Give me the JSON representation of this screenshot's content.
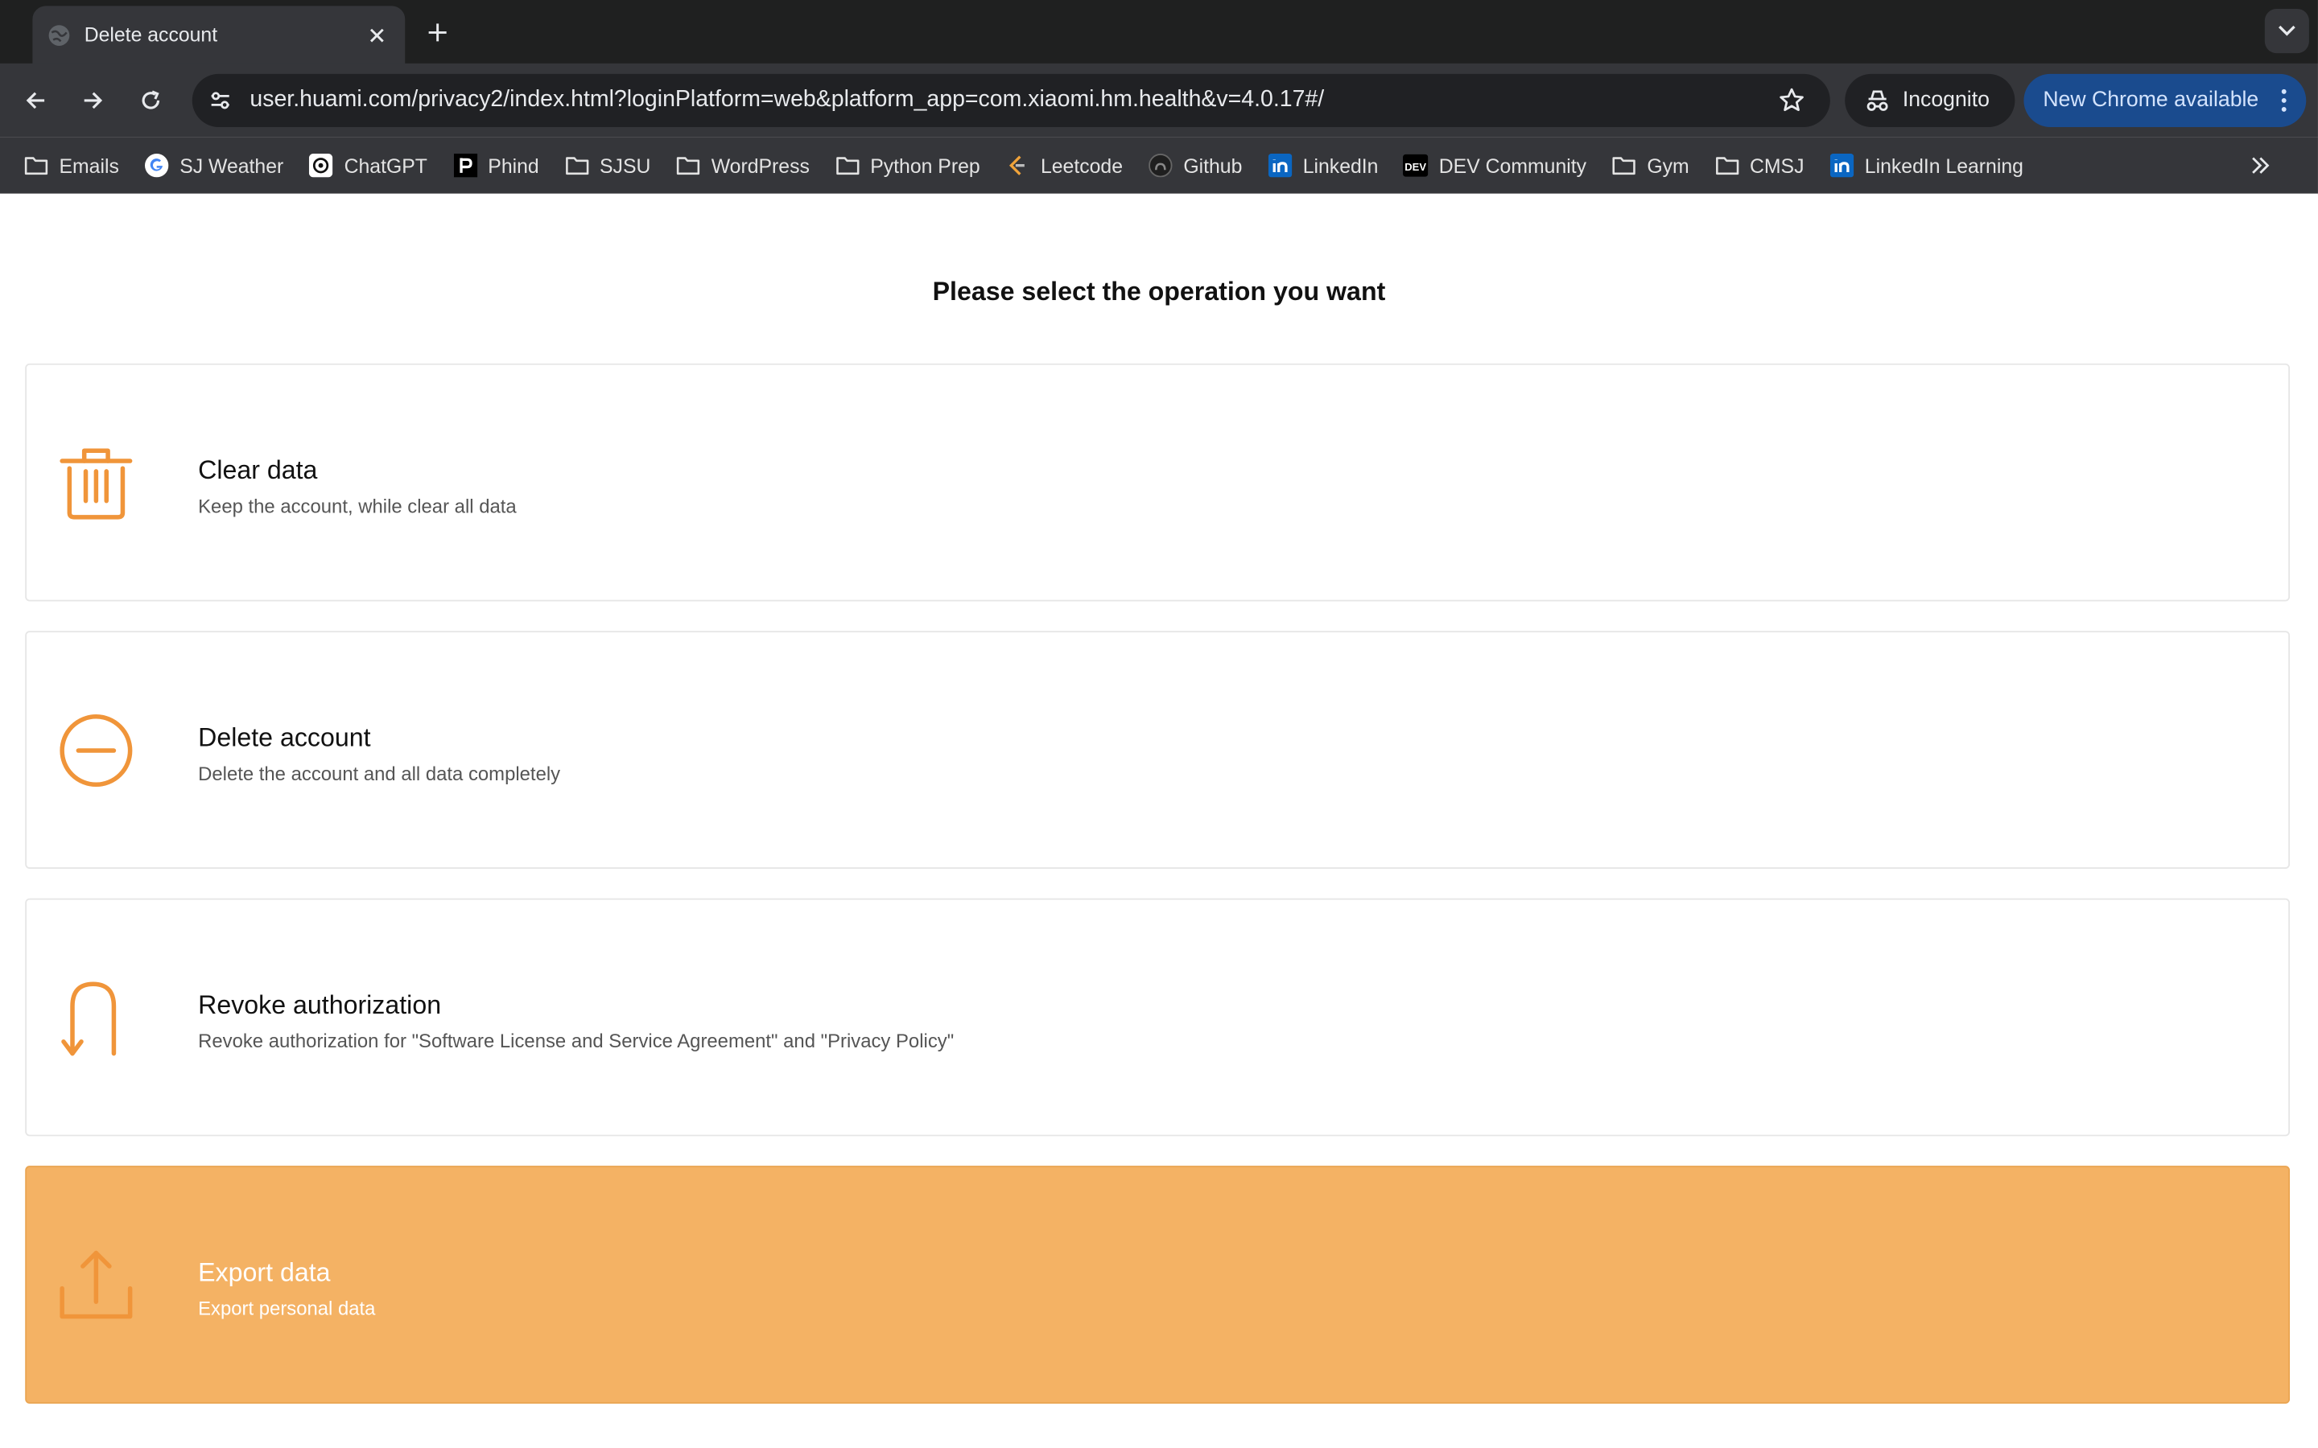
{
  "browser": {
    "tab_title": "Delete account",
    "url": "user.huami.com/privacy2/index.html?loginPlatform=web&platform_app=com.xiaomi.hm.health&v=4.0.17#/",
    "incognito_label": "Incognito",
    "update_label": "New Chrome available",
    "bookmarks": [
      {
        "label": "Emails",
        "icon": "folder-icon"
      },
      {
        "label": "SJ Weather",
        "icon": "google-icon"
      },
      {
        "label": "ChatGPT",
        "icon": "chatgpt-icon"
      },
      {
        "label": "Phind",
        "icon": "phind-icon"
      },
      {
        "label": "SJSU",
        "icon": "folder-icon"
      },
      {
        "label": "WordPress",
        "icon": "folder-icon"
      },
      {
        "label": "Python Prep",
        "icon": "folder-icon"
      },
      {
        "label": "Leetcode",
        "icon": "leetcode-icon"
      },
      {
        "label": "Github",
        "icon": "github-icon"
      },
      {
        "label": "LinkedIn",
        "icon": "linkedin-icon"
      },
      {
        "label": "DEV Community",
        "icon": "dev-icon"
      },
      {
        "label": "Gym",
        "icon": "folder-icon"
      },
      {
        "label": "CMSJ",
        "icon": "folder-icon"
      },
      {
        "label": "LinkedIn Learning",
        "icon": "linkedin-icon"
      }
    ]
  },
  "page": {
    "heading": "Please select the operation you want",
    "options": [
      {
        "title": "Clear data",
        "desc": "Keep the account, while clear all data",
        "icon": "trash-icon",
        "selected": false
      },
      {
        "title": "Delete account",
        "desc": "Delete the account and all data completely",
        "icon": "minus-circle-icon",
        "selected": false
      },
      {
        "title": "Revoke authorization",
        "desc": "Revoke authorization for \"Software License and Service Agreement\" and \"Privacy Policy\"",
        "icon": "revoke-arrow-icon",
        "selected": false
      },
      {
        "title": "Export data",
        "desc": "Export personal data",
        "icon": "export-icon",
        "selected": true
      }
    ],
    "colors": {
      "accent": "#f0953a",
      "selected_bg": "#f4b264"
    }
  }
}
